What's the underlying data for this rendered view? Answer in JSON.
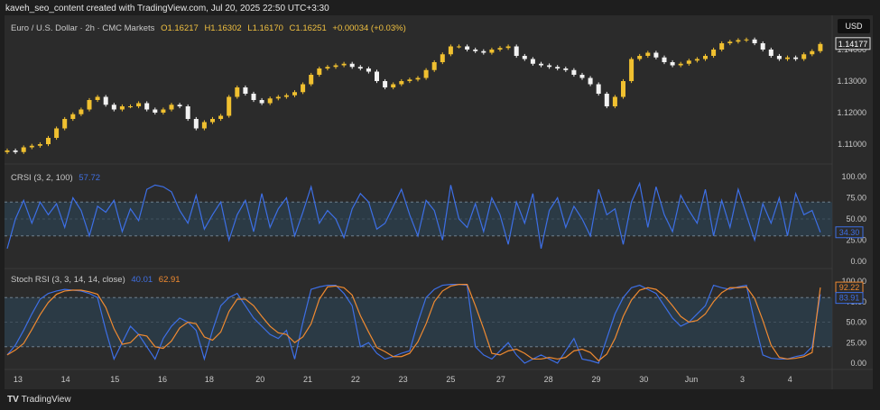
{
  "credit": "kaveh_seo_content created with TradingView.com, Jul 20, 2025 22:50 UTC+3:30",
  "header": {
    "symbol": "Euro / U.S. Dollar · 2h · CMC Markets",
    "open": "O1.16217",
    "high": "H1.16302",
    "low": "L1.16170",
    "close": "C1.16251",
    "change": "+0.00034 (+0.03%)"
  },
  "currency_button": "USD",
  "footer_logo": "TradingView",
  "colors": {
    "up": "#f0c030",
    "down": "#f2f2f2",
    "crsi": "#3d6fe6",
    "stoch_k": "#3d6fe6",
    "stoch_d": "#f08a30",
    "band": "#2c3d4a"
  },
  "chart_data": [
    {
      "type": "candlestick",
      "title": "Euro / U.S. Dollar · 2h · CMC Markets",
      "y_ticks": [
        "1.14000",
        "1.13000",
        "1.12000",
        "1.11000"
      ],
      "y_tick_values": [
        1.14,
        1.13,
        1.12,
        1.11
      ],
      "last_price_label": "1.14177",
      "close": [
        1.108,
        1.1075,
        1.109,
        1.1095,
        1.11,
        1.112,
        1.115,
        1.118,
        1.1195,
        1.121,
        1.124,
        1.125,
        1.1225,
        1.121,
        1.122,
        1.122,
        1.123,
        1.121,
        1.12,
        1.121,
        1.1225,
        1.122,
        1.118,
        1.115,
        1.117,
        1.118,
        1.119,
        1.125,
        1.128,
        1.126,
        1.124,
        1.123,
        1.1245,
        1.125,
        1.1255,
        1.1265,
        1.129,
        1.132,
        1.134,
        1.1345,
        1.135,
        1.1355,
        1.1345,
        1.134,
        1.133,
        1.13,
        1.128,
        1.129,
        1.13,
        1.1305,
        1.131,
        1.1335,
        1.136,
        1.1385,
        1.141,
        1.141,
        1.14,
        1.1395,
        1.139,
        1.14,
        1.1405,
        1.141,
        1.138,
        1.137,
        1.1355,
        1.135,
        1.1345,
        1.134,
        1.1335,
        1.132,
        1.131,
        1.129,
        1.126,
        1.122,
        1.125,
        1.13,
        1.137,
        1.138,
        1.139,
        1.1375,
        1.136,
        1.135,
        1.1355,
        1.1365,
        1.137,
        1.138,
        1.14,
        1.142,
        1.1425,
        1.143,
        1.1432,
        1.142,
        1.14,
        1.138,
        1.137,
        1.1375,
        1.137,
        1.1385,
        1.1395,
        1.14177
      ]
    },
    {
      "type": "line",
      "title": "CRSI (3, 2, 100)",
      "header_value": "57.72",
      "last_value_label": "34.30",
      "ylim": [
        0,
        100
      ],
      "y_ticks": [
        "100.00",
        "75.00",
        "50.00",
        "25.00",
        "0.00"
      ],
      "band": [
        30,
        70
      ],
      "values": [
        15,
        50,
        72,
        45,
        70,
        55,
        68,
        40,
        75,
        60,
        30,
        65,
        58,
        72,
        35,
        62,
        48,
        85,
        90,
        88,
        82,
        60,
        45,
        78,
        38,
        55,
        70,
        25,
        55,
        72,
        35,
        80,
        40,
        62,
        75,
        30,
        58,
        88,
        45,
        60,
        50,
        28,
        62,
        80,
        70,
        38,
        45,
        65,
        85,
        55,
        30,
        72,
        60,
        25,
        90,
        50,
        40,
        68,
        35,
        75,
        55,
        20,
        70,
        45,
        80,
        15,
        60,
        75,
        40,
        65,
        50,
        30,
        85,
        55,
        62,
        20,
        70,
        92,
        40,
        88,
        55,
        35,
        78,
        60,
        45,
        85,
        30,
        72,
        40,
        85,
        55,
        25,
        68,
        45,
        75,
        30,
        80,
        55,
        60,
        34.3
      ]
    },
    {
      "type": "line",
      "title": "Stoch RSI (3, 3, 14, 14, close)",
      "header_k": "40.01",
      "header_d": "62.91",
      "last_d_label": "92.22",
      "last_k_label": "83.91",
      "ylim": [
        0,
        100
      ],
      "y_ticks": [
        "100.00",
        "75.00",
        "50.00",
        "25.00",
        "0.00"
      ],
      "band": [
        20,
        80
      ],
      "k": [
        10,
        22,
        40,
        60,
        78,
        85,
        88,
        90,
        89,
        88,
        85,
        80,
        40,
        5,
        25,
        45,
        35,
        20,
        5,
        30,
        45,
        55,
        50,
        40,
        5,
        40,
        70,
        80,
        85,
        70,
        55,
        45,
        35,
        30,
        40,
        5,
        50,
        90,
        93,
        95,
        95,
        85,
        70,
        20,
        25,
        12,
        5,
        8,
        12,
        15,
        50,
        80,
        90,
        95,
        96,
        96,
        95,
        20,
        10,
        5,
        15,
        25,
        10,
        0,
        5,
        10,
        5,
        0,
        15,
        30,
        5,
        3,
        0,
        30,
        60,
        80,
        92,
        95,
        90,
        85,
        70,
        55,
        45,
        50,
        60,
        70,
        95,
        92,
        90,
        93,
        95,
        50,
        10,
        6,
        5,
        5,
        8,
        10,
        20,
        83.91
      ],
      "d": [
        10,
        16,
        24,
        41,
        59,
        74,
        84,
        88,
        89,
        89,
        87,
        84,
        68,
        42,
        23,
        25,
        35,
        33,
        20,
        18,
        27,
        43,
        50,
        48,
        32,
        28,
        38,
        63,
        78,
        78,
        70,
        57,
        45,
        37,
        35,
        25,
        32,
        48,
        78,
        93,
        94,
        92,
        83,
        58,
        38,
        19,
        14,
        8,
        8,
        12,
        26,
        48,
        75,
        88,
        94,
        96,
        96,
        70,
        42,
        12,
        10,
        15,
        17,
        12,
        5,
        5,
        7,
        5,
        7,
        15,
        17,
        13,
        3,
        11,
        30,
        57,
        77,
        89,
        92,
        90,
        82,
        70,
        57,
        50,
        52,
        60,
        75,
        86,
        92,
        92,
        93,
        79,
        52,
        22,
        7,
        5,
        6,
        8,
        13,
        92.22
      ]
    }
  ],
  "x_axis": {
    "labels": [
      "13",
      "14",
      "15",
      "16",
      "18",
      "20",
      "21",
      "22",
      "23",
      "25",
      "27",
      "28",
      "29",
      "30",
      "Jun",
      "3",
      "4"
    ],
    "bar_index": [
      1.3,
      7.1,
      13.1,
      18.9,
      24.6,
      30.8,
      36.6,
      42.4,
      48.2,
      54,
      60.1,
      65.9,
      71.7,
      77.5,
      83.3,
      89.5,
      95.3
    ]
  }
}
